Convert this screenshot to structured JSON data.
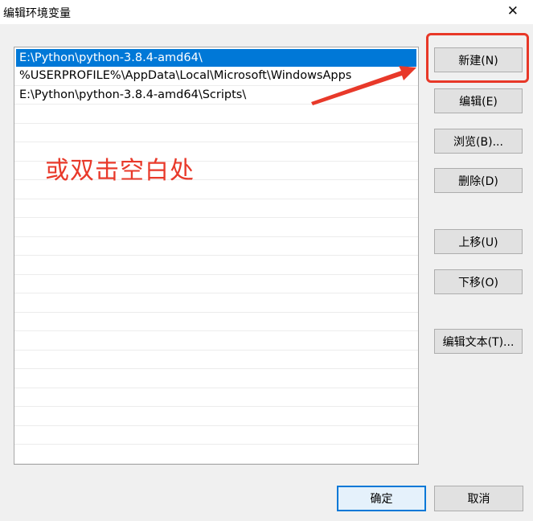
{
  "window": {
    "title": "编辑环境变量",
    "close_glyph": "✕"
  },
  "list": {
    "items": [
      "E:\\Python\\python-3.8.4-amd64\\",
      "%USERPROFILE%\\AppData\\Local\\Microsoft\\WindowsApps",
      "E:\\Python\\python-3.8.4-amd64\\Scripts\\"
    ],
    "selected_index": 0
  },
  "buttons": {
    "new": "新建(N)",
    "edit": "编辑(E)",
    "browse": "浏览(B)...",
    "delete": "删除(D)",
    "move_up": "上移(U)",
    "move_down": "下移(O)",
    "edit_text": "编辑文本(T)...",
    "ok": "确定",
    "cancel": "取消"
  },
  "annotation": {
    "text": "或双击空白处",
    "color": "#e8392a"
  },
  "colors": {
    "selection": "#0078d7",
    "highlight_box": "#e83828"
  }
}
